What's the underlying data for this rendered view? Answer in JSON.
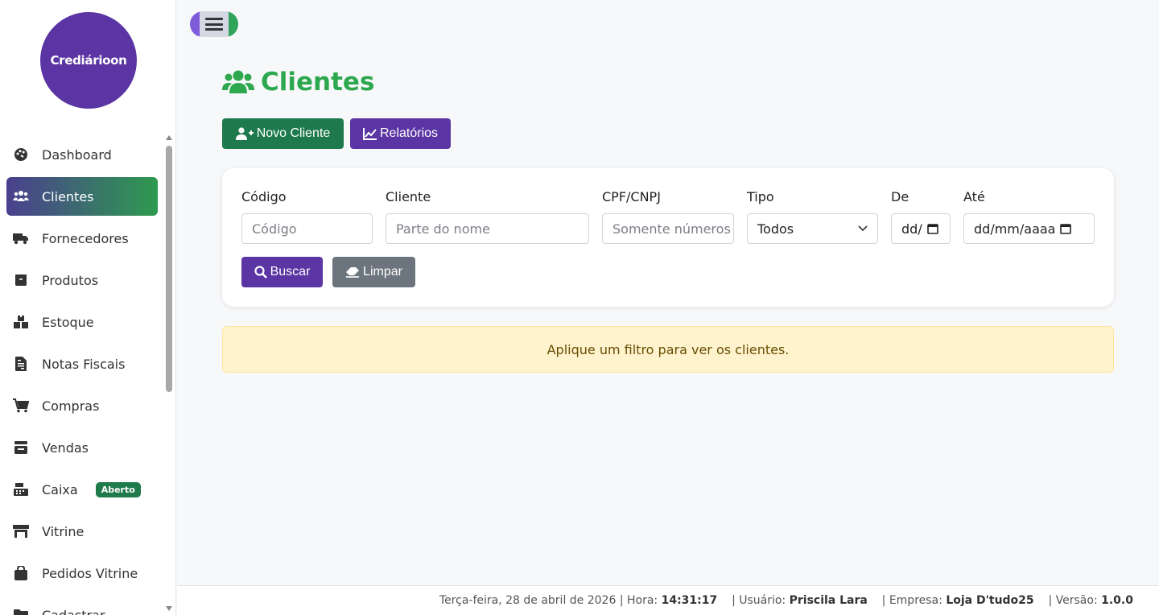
{
  "brand": {
    "logo_text": "Crediárioon"
  },
  "sidebar": {
    "items": [
      {
        "label": "Dashboard",
        "icon": "palette-icon"
      },
      {
        "label": "Clientes",
        "icon": "users-icon",
        "active": true
      },
      {
        "label": "Fornecedores",
        "icon": "truck-icon"
      },
      {
        "label": "Produtos",
        "icon": "box-icon"
      },
      {
        "label": "Estoque",
        "icon": "boxes-icon"
      },
      {
        "label": "Notas Fiscais",
        "icon": "file-invoice-icon"
      },
      {
        "label": "Compras",
        "icon": "cart-icon"
      },
      {
        "label": "Vendas",
        "icon": "cash-register-icon"
      },
      {
        "label": "Caixa",
        "icon": "calculator-icon",
        "badge": "Aberto"
      },
      {
        "label": "Vitrine",
        "icon": "store-icon"
      },
      {
        "label": "Pedidos Vitrine",
        "icon": "bag-icon"
      },
      {
        "label": "Cadastrar",
        "icon": "folder-icon"
      }
    ]
  },
  "page": {
    "title": "Clientes",
    "new_button": "Novo Cliente",
    "reports_button": "Relatórios"
  },
  "filters": {
    "codigo_label": "Código",
    "codigo_placeholder": "Código",
    "cliente_label": "Cliente",
    "cliente_placeholder": "Parte do nome",
    "cpf_label": "CPF/CNPJ",
    "cpf_placeholder": "Somente números",
    "tipo_label": "Tipo",
    "tipo_value": "Todos",
    "de_label": "De",
    "de_value": "dd/",
    "ate_label": "Até",
    "ate_value": "dd/mm/aaaa",
    "search_button": "Buscar",
    "clear_button": "Limpar"
  },
  "alert": {
    "message": "Aplique um filtro para ver os clientes."
  },
  "footer": {
    "date": "Terça-feira, 28 de abril de 2026",
    "time_label": "| Hora:",
    "time": "14:31:17",
    "user_label": "| Usuário:",
    "user": "Priscila Lara",
    "company_label": "| Empresa:",
    "company": "Loja D'tudo25",
    "version_label": "| Versão:",
    "version": "1.0.0"
  },
  "colors": {
    "brand_purple": "#5a35a3",
    "brand_green": "#2ea84f",
    "dark_green": "#1e7a4d"
  }
}
